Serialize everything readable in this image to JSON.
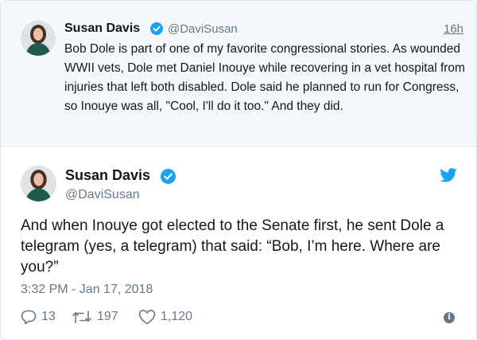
{
  "parent_tweet": {
    "author_name": "Susan Davis",
    "handle": "@DaviSusan",
    "time": "16h",
    "text": "Bob Dole is part of one of my favorite congressional stories. As wounded WWII vets, Dole met Daniel Inouye while recovering in a vet hospital from injuries that left both disabled. Dole said he planned to run for Congress, so Inouye was all, \"Cool, I'll do it too.\" And they did."
  },
  "main_tweet": {
    "author_name": "Susan Davis",
    "handle": "@DaviSusan",
    "text": "And when Inouye got elected to the Senate first, he sent Dole a telegram (yes, a telegram) that said: “Bob, I’m here. Where are you?”",
    "timestamp": "3:32 PM - Jan 17, 2018"
  },
  "actions": {
    "reply_count": "13",
    "retweet_count": "197",
    "like_count": "1,120"
  },
  "icons": {
    "verified": "verified-badge-icon",
    "brand": "twitter-bird-icon",
    "reply": "reply-icon",
    "retweet": "retweet-icon",
    "like": "heart-icon",
    "info": "info-icon"
  },
  "colors": {
    "brand_blue": "#1da1f2",
    "secondary_text": "#657786",
    "parent_background": "#f5f8fa",
    "avatar_dress": "#1e5b4a"
  }
}
